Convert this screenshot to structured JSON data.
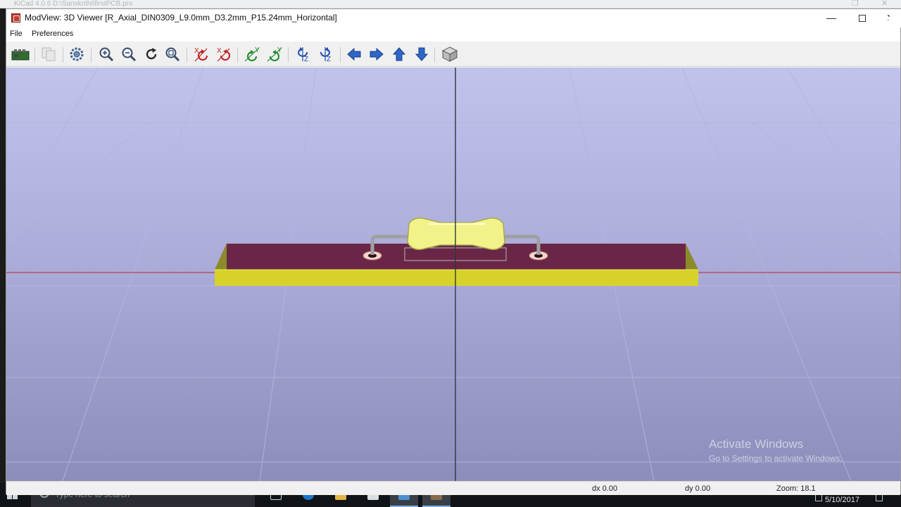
{
  "background_window": {
    "title": "KiCad 4.0.6 D:\\Sanskrithi\\firstPCB.pro"
  },
  "window": {
    "title": "ModView: 3D Viewer [R_Axial_DIN0309_L9.0mm_D3.2mm_P15.24mm_Horizontal]",
    "minimize_glyph": "—",
    "close_glyph": "✕"
  },
  "menu": {
    "items": [
      "File",
      "Preferences"
    ]
  },
  "toolbar": {
    "tools": [
      {
        "name": "reload-board-icon"
      },
      {
        "name": "copy-to-clipboard-icon"
      },
      {
        "name": "settings-gear-icon"
      },
      {
        "name": "zoom-in-icon"
      },
      {
        "name": "zoom-out-icon"
      },
      {
        "name": "redraw-icon"
      },
      {
        "name": "zoom-fit-icon"
      },
      {
        "name": "rotate-x-cw-icon"
      },
      {
        "name": "rotate-x-ccw-icon"
      },
      {
        "name": "rotate-y-cw-icon"
      },
      {
        "name": "rotate-y-ccw-icon"
      },
      {
        "name": "rotate-z-cw-icon"
      },
      {
        "name": "rotate-z-ccw-icon"
      },
      {
        "name": "move-left-icon"
      },
      {
        "name": "move-right-icon"
      },
      {
        "name": "move-up-icon"
      },
      {
        "name": "move-down-icon"
      },
      {
        "name": "ortho-view-icon"
      }
    ]
  },
  "viewport": {
    "background_top": "#c1c3ec",
    "background_bottom": "#8d8dbb",
    "board_color": "#6a2647",
    "board_edge_color": "#d7d22a",
    "resistor_body_color": "#f2f28a",
    "lead_color": "#a0a0a0",
    "x_axis_color": "#b04850",
    "y_axis_color": "#2a3a36"
  },
  "statusbar": {
    "dx": "dx 0.00",
    "dy": "dy 0.00",
    "zoom": "Zoom: 18.1"
  },
  "watermark": {
    "line1": "Activate Windows",
    "line2": "Go to Settings to activate Windows."
  },
  "taskbar": {
    "search_placeholder": "Type here to search",
    "date": "5/10/2017"
  }
}
